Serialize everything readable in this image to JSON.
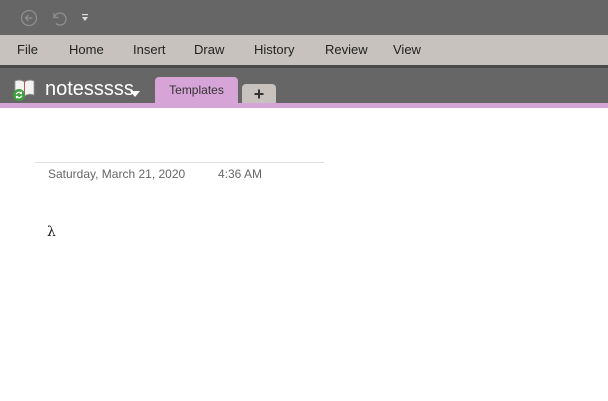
{
  "quick_access": {
    "back_icon": "back-circle-icon",
    "undo_icon": "undo-icon",
    "customize_icon": "customize-qat-icon"
  },
  "menu": {
    "items": [
      "File",
      "Home",
      "Insert",
      "Draw",
      "History",
      "Review",
      "View"
    ]
  },
  "notebook": {
    "name": "notesssss",
    "icon": "notebook-sync-icon"
  },
  "sections": {
    "active_tab": "Templates",
    "add_label": "+"
  },
  "page": {
    "date": "Saturday, March 21, 2020",
    "time": "4:36 AM",
    "content": "λ"
  },
  "colors": {
    "titlebar": "#666666",
    "menubar": "#c7c2be",
    "section_accent": "#d7a4d7"
  }
}
